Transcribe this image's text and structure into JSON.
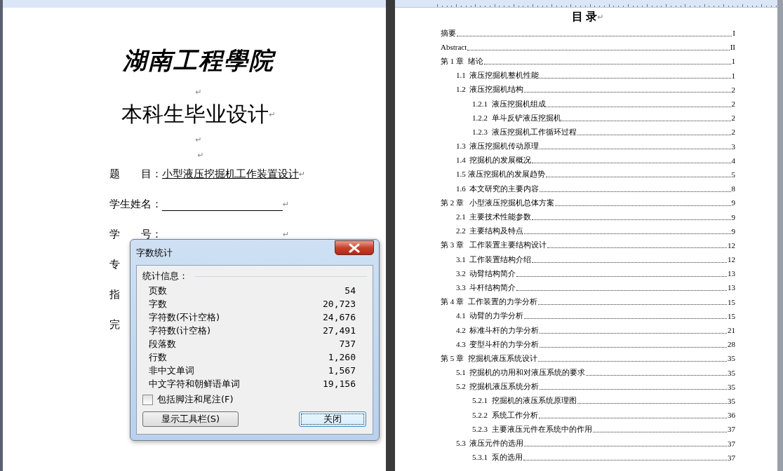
{
  "cover_page": {
    "lines": [
      {
        "kind": "logo",
        "text": "湖南工程學院"
      },
      {
        "kind": "blank",
        "mark": "↵"
      },
      {
        "kind": "heading",
        "text": "本科生毕业设计",
        "mark": "↵"
      },
      {
        "kind": "blank",
        "mark": "↵"
      },
      {
        "kind": "blank",
        "mark": "↵"
      },
      {
        "kind": "field",
        "label": "题　　目：",
        "value": "小型液压挖掘机工作装置设计",
        "mark": "↵"
      },
      {
        "kind": "blank_field",
        "label": "学生姓名：",
        "mark": "↵"
      },
      {
        "kind": "covered_field",
        "label": "学　　号：",
        "mark": "↵"
      },
      {
        "kind": "cut_label",
        "label": "专"
      },
      {
        "kind": "cut_label",
        "label": "指"
      },
      {
        "kind": "cut_label",
        "label": "完"
      }
    ]
  },
  "toc_page": {
    "title": "目 录",
    "title_mark": "↵",
    "entries": [
      {
        "text": "摘要",
        "page": "I"
      },
      {
        "text": "Abstract",
        "page": "II"
      },
      {
        "text": "第 1 章  绪论",
        "page": "1",
        "children": [
          {
            "text": "1.1  液压挖掘机整机性能",
            "page": "1"
          },
          {
            "text": "1.2  液压挖掘机结构",
            "page": "2",
            "children": [
              {
                "text": "1.2.1  液压挖掘机组成",
                "page": "2"
              },
              {
                "text": "1.2.2  单斗反铲液压挖掘机",
                "page": "2"
              },
              {
                "text": "1.2.3  液压挖掘机工作循环过程",
                "page": "2"
              }
            ]
          },
          {
            "text": "1.3  液压挖掘机传动原理",
            "page": "3"
          },
          {
            "text": "1.4  挖掘机的发展概况",
            "page": "4"
          },
          {
            "text": "1.5 液压挖掘机的发展趋势",
            "page": "5"
          },
          {
            "text": "1.6  本文研究的主要内容",
            "page": "8"
          }
        ]
      },
      {
        "text": "第 2 章   小型液压挖掘机总体方案",
        "page": "9",
        "children": [
          {
            "text": "2.1  主要技术性能参数",
            "page": "9"
          },
          {
            "text": "2.2  主要结构及特点",
            "page": "9"
          }
        ]
      },
      {
        "text": "第 3 章   工作装置主要结构设计",
        "page": "12",
        "children": [
          {
            "text": "3.1  工作装置结构介绍",
            "page": "12"
          },
          {
            "text": "3.2  动臂结构简介",
            "page": "13"
          },
          {
            "text": "3.3  斗杆结构简介",
            "page": "13"
          }
        ]
      },
      {
        "text": "第 4 章  工作装置的力学分析",
        "page": "15",
        "children": [
          {
            "text": "4.1  动臂的力学分析",
            "page": "15"
          },
          {
            "text": "4.2  标准斗杆的力学分析",
            "page": "21"
          },
          {
            "text": "4.3  变型斗杆的力学分析",
            "page": "28"
          }
        ]
      },
      {
        "text": "第 5 章  挖掘机液压系统设计",
        "page": "35",
        "children": [
          {
            "text": "5.1  挖掘机的功用和对液压系统的要求",
            "page": "35"
          },
          {
            "text": "5.2  挖掘机液压系统分析",
            "page": "35",
            "children": [
              {
                "text": "5.2.1  挖掘机的液压系统原理图",
                "page": "35"
              },
              {
                "text": "5.2.2  系统工作分析",
                "page": "36"
              },
              {
                "text": "5.2.3  主要液压元件在系统中的作用",
                "page": "37"
              }
            ]
          },
          {
            "text": "5.3  液压元件的选用",
            "page": "37",
            "children": [
              {
                "text": "5.3.1  泵的选用",
                "page": "37"
              }
            ]
          }
        ]
      }
    ]
  },
  "dialog": {
    "title": "字数统计",
    "group_label": "统计信息：",
    "stats": [
      {
        "label": "页数",
        "value": "54"
      },
      {
        "label": "字数",
        "value": "20,723"
      },
      {
        "label": "字符数(不计空格)",
        "value": "24,676"
      },
      {
        "label": "字符数(计空格)",
        "value": "27,491"
      },
      {
        "label": "段落数",
        "value": "737"
      },
      {
        "label": "行数",
        "value": "1,260"
      },
      {
        "label": "非中文单词",
        "value": "1,567"
      },
      {
        "label": "中文字符和朝鲜语单词",
        "value": "19,156"
      }
    ],
    "checkbox": {
      "label": "包括脚注和尾注(F)",
      "checked": false
    },
    "buttons": [
      {
        "label": "显示工具栏(S)",
        "default": false
      },
      {
        "label": "关闭",
        "default": true
      }
    ]
  }
}
